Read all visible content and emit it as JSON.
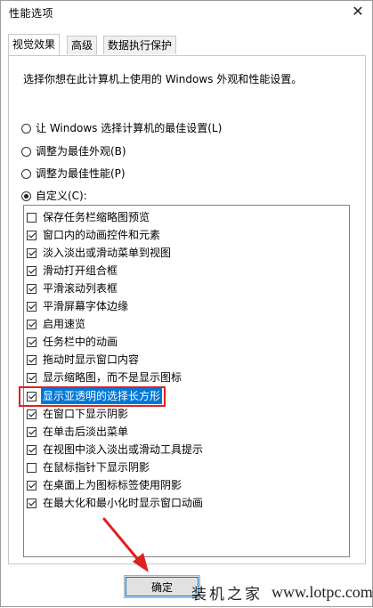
{
  "window": {
    "title": "性能选项",
    "close_glyph": "✕"
  },
  "tabs": [
    {
      "label": "视觉效果",
      "active": true
    },
    {
      "label": "高级",
      "active": false
    },
    {
      "label": "数据执行保护",
      "active": false
    }
  ],
  "panel": {
    "description": "选择你想在此计算机上使用的 Windows 外观和性能设置。"
  },
  "radios": [
    {
      "label": "让 Windows 选择计算机的最佳设置(L)",
      "checked": false
    },
    {
      "label": "调整为最佳外观(B)",
      "checked": false
    },
    {
      "label": "调整为最佳性能(P)",
      "checked": false
    },
    {
      "label": "自定义(C):",
      "checked": true
    }
  ],
  "options": [
    {
      "label": "保存任务栏缩略图预览",
      "checked": false
    },
    {
      "label": "窗口内的动画控件和元素",
      "checked": true
    },
    {
      "label": "淡入淡出或滑动菜单到视图",
      "checked": true
    },
    {
      "label": "滑动打开组合框",
      "checked": true
    },
    {
      "label": "平滑滚动列表框",
      "checked": true
    },
    {
      "label": "平滑屏幕字体边缘",
      "checked": true
    },
    {
      "label": "启用速览",
      "checked": true
    },
    {
      "label": "任务栏中的动画",
      "checked": true
    },
    {
      "label": "拖动时显示窗口内容",
      "checked": true
    },
    {
      "label": "显示缩略图，而不是显示图标",
      "checked": true
    },
    {
      "label": "显示亚透明的选择长方形",
      "checked": true,
      "selected": true
    },
    {
      "label": "在窗口下显示阴影",
      "checked": true
    },
    {
      "label": "在单击后淡出菜单",
      "checked": true
    },
    {
      "label": "在视图中淡入淡出或滑动工具提示",
      "checked": true
    },
    {
      "label": "在鼠标指针下显示阴影",
      "checked": false
    },
    {
      "label": "在桌面上为图标标签使用阴影",
      "checked": true
    },
    {
      "label": "在最大化和最小化时显示窗口动画",
      "checked": true
    }
  ],
  "buttons": {
    "ok_label": "确定"
  },
  "watermark": {
    "text": "装机之家",
    "url": "www.lotpc.com"
  },
  "colors": {
    "selection": "#0078d7",
    "annotation_red": "#e02020"
  }
}
